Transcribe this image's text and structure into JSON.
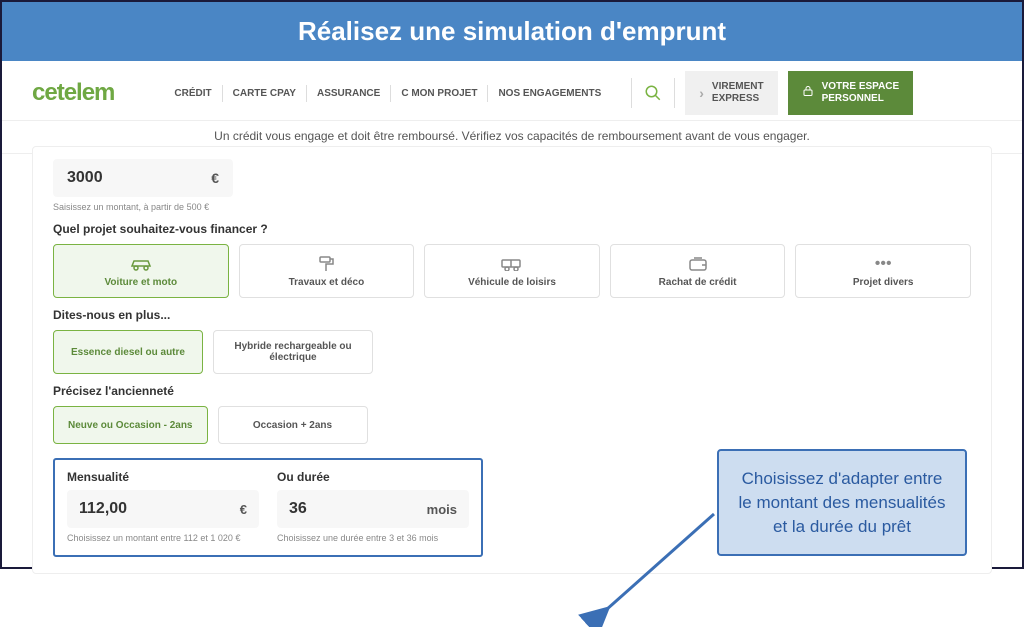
{
  "title": "Réalisez une simulation d'emprunt",
  "logo": "cetelem",
  "nav": [
    "CRÉDIT",
    "CARTE CPAY",
    "ASSURANCE",
    "C MON PROJET",
    "NOS ENGAGEMENTS"
  ],
  "virement": "VIREMENT\nEXPRESS",
  "espace": "VOTRE ESPACE\nPERSONNEL",
  "warning": "Un crédit vous engage et doit être remboursé. Vérifiez vos capacités de remboursement avant de vous engager.",
  "amount": {
    "value": "3000",
    "unit": "€",
    "hint": "Saisissez un montant, à partir de 500 €"
  },
  "project": {
    "label": "Quel projet souhaitez-vous financer ?",
    "cards": [
      {
        "label": "Voiture et moto",
        "selected": true
      },
      {
        "label": "Travaux et déco",
        "selected": false
      },
      {
        "label": "Véhicule de loisirs",
        "selected": false
      },
      {
        "label": "Rachat de crédit",
        "selected": false
      },
      {
        "label": "Projet divers",
        "selected": false
      }
    ]
  },
  "more": {
    "label": "Dites-nous en plus...",
    "options": [
      {
        "label": "Essence diesel ou autre",
        "selected": true
      },
      {
        "label": "Hybride rechargeable ou électrique",
        "selected": false
      }
    ]
  },
  "age": {
    "label": "Précisez l'ancienneté",
    "options": [
      {
        "label": "Neuve ou Occasion - 2ans",
        "selected": true
      },
      {
        "label": "Occasion + 2ans",
        "selected": false
      }
    ]
  },
  "mensualite": {
    "label": "Mensualité",
    "value": "112,00",
    "unit": "€",
    "hint": "Choisissez un montant entre 112 et 1 020 €"
  },
  "duree": {
    "label": "Ou durée",
    "value": "36",
    "unit": "mois",
    "hint": "Choisissez une durée entre 3 et 36 mois"
  },
  "callout": "Choisissez d'adapter entre le montant des mensualités et la durée du prêt"
}
